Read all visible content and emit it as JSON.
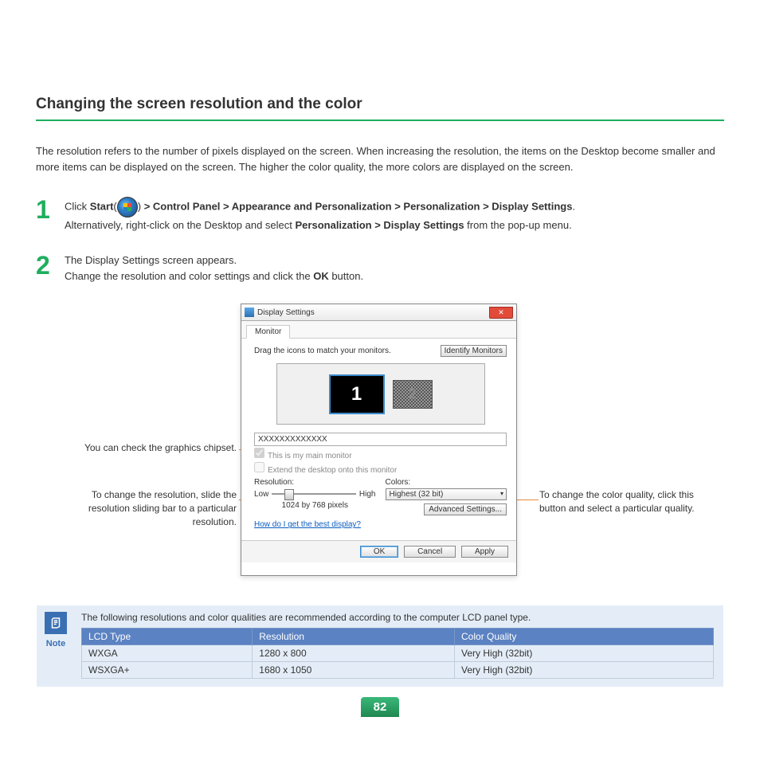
{
  "title": "Changing the screen resolution and the color",
  "intro": "The resolution refers to the number of pixels displayed on the screen. When increasing the resolution, the items on the Desktop become smaller and more items can be displayed on the screen. The higher the color quality, the more colors are displayed on the screen.",
  "step1": {
    "num": "1",
    "prefix": "Click ",
    "start_bold": "Start",
    "openp": "(",
    "closep": ") ",
    "path": "> Control Panel > Appearance and Personalization > Personalization > Display Settings",
    "dot": ".",
    "alt1": "Alternatively, right-click on the Desktop and select ",
    "alt_bold": "Personalization > Display Settings",
    "alt2": " from the pop-up menu."
  },
  "step2": {
    "num": "2",
    "line1": "The Display Settings screen appears.",
    "line2a": "Change the resolution and color settings and click the ",
    "ok_bold": "OK",
    "line2b": " button."
  },
  "dialog": {
    "title": "Display Settings",
    "close": "✕",
    "tab": "Monitor",
    "instr": "Drag the icons to match your monitors.",
    "identify": "Identify Monitors",
    "m1": "1",
    "m2": "2",
    "chipset": "XXXXXXXXXXXXX",
    "cb1": "This is my main monitor",
    "cb2": "Extend the desktop onto this monitor",
    "res_lbl": "Resolution:",
    "low": "Low",
    "high": "High",
    "res_val": "1024 by 768 pixels",
    "col_lbl": "Colors:",
    "col_val": "Highest (32 bit)",
    "link": "How do I get the best display?",
    "adv": "Advanced Settings...",
    "ok": "OK",
    "cancel": "Cancel",
    "apply": "Apply"
  },
  "callouts": {
    "left1": "You can check the graphics chipset.",
    "left2": "To change the resolution, slide the resolution sliding bar to a particular resolution.",
    "right1": "To change the color quality, click this button and select a particular quality."
  },
  "note": {
    "label": "Note",
    "text": "The following resolutions and color qualities are recommended according to the computer LCD panel type.",
    "headers": [
      "LCD Type",
      "Resolution",
      "Color Quality"
    ],
    "rows": [
      [
        "WXGA",
        "1280 x 800",
        "Very High (32bit)"
      ],
      [
        "WSXGA+",
        "1680 x 1050",
        "Very High (32bit)"
      ]
    ]
  },
  "page_num": "82"
}
